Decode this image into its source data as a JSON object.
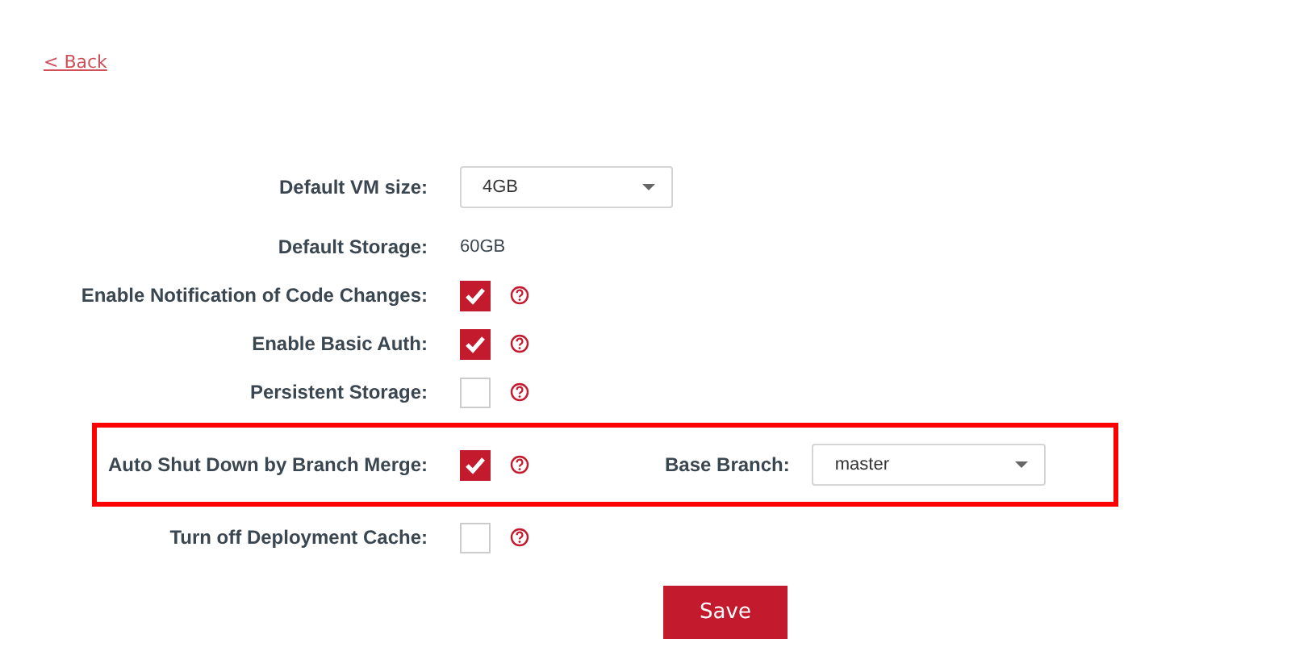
{
  "back_link": {
    "icon": "<",
    "label": "Back"
  },
  "settings": [
    {
      "kind": "select",
      "label": "Default VM size:",
      "value": "4GB"
    },
    {
      "kind": "text",
      "label": "Default Storage:",
      "value": "60GB"
    },
    {
      "kind": "checkbox",
      "label": "Enable Notification of Code Changes:",
      "checked": true,
      "highlighted": false
    },
    {
      "kind": "checkbox",
      "label": "Enable Basic Auth:",
      "checked": true,
      "highlighted": false
    },
    {
      "kind": "checkbox",
      "label": "Persistent Storage:",
      "checked": false,
      "highlighted": false
    },
    {
      "kind": "checkbox",
      "label": "Auto Shut Down by Branch Merge:",
      "checked": true,
      "highlighted": true,
      "extra": {
        "label": "Base Branch:",
        "value": "master"
      }
    },
    {
      "kind": "checkbox",
      "label": "Turn off Deployment Cache:",
      "checked": false,
      "highlighted": false
    }
  ],
  "save_button": "Save"
}
